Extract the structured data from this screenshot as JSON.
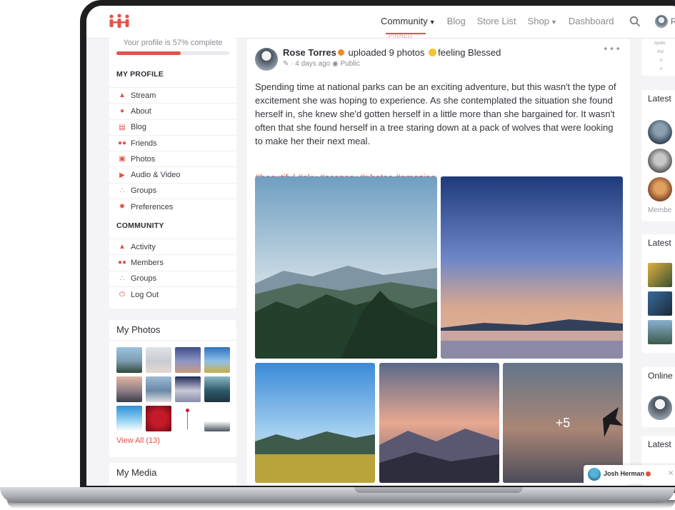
{
  "nav": {
    "items": [
      {
        "label": "Community",
        "dropdown": true,
        "active": true
      },
      {
        "label": "Blog",
        "dropdown": false,
        "active": false
      },
      {
        "label": "Store List",
        "dropdown": false,
        "active": false
      },
      {
        "label": "Shop",
        "dropdown": true,
        "active": false
      },
      {
        "label": "Dashboard",
        "dropdown": false,
        "active": false
      }
    ],
    "user_initial": "R"
  },
  "profile": {
    "completion_text": "Your profile is 57% complete",
    "completion_percent": 57
  },
  "sidebar": {
    "my_profile_heading": "MY PROFILE",
    "my_profile_items": [
      {
        "label": "Stream",
        "icon": "stream-icon"
      },
      {
        "label": "About",
        "icon": "person-icon"
      },
      {
        "label": "Blog",
        "icon": "blog-icon"
      },
      {
        "label": "Friends",
        "icon": "friends-icon"
      },
      {
        "label": "Photos",
        "icon": "camera-icon"
      },
      {
        "label": "Audio & Video",
        "icon": "video-icon"
      },
      {
        "label": "Groups",
        "icon": "groups-icon"
      },
      {
        "label": "Preferences",
        "icon": "gear-icon"
      }
    ],
    "community_heading": "COMMUNITY",
    "community_items": [
      {
        "label": "Activity",
        "icon": "activity-icon"
      },
      {
        "label": "Members",
        "icon": "members-icon"
      },
      {
        "label": "Groups",
        "icon": "groups-icon"
      },
      {
        "label": "Log Out",
        "icon": "power-icon"
      }
    ]
  },
  "my_photos": {
    "title": "My Photos",
    "view_all": "View All (13)"
  },
  "my_media": {
    "title": "My Media"
  },
  "post": {
    "pinned_label": "PINNED",
    "author": "Rose Torres",
    "action": "uploaded 9 photos",
    "feeling": "feeling Blessed",
    "time": "· 4 days ago",
    "visibility": "Public",
    "body": "Spending time at national parks can be an exciting adventure, but this wasn't the type of excitement she was hoping to experience. As she contemplated the situation she found herself in, she knew she'd gotten herself in a little more than she bargained for. It wasn't often that she found herself in a tree staring down at a pack of wolves that were looking to make her their next meal.",
    "hashtags": "#beautiful #sky #scenery #photos #amazing",
    "more_photos": "+5"
  },
  "right_sidebar": {
    "tags": [
      "#polls",
      "#sc",
      "#",
      "#"
    ],
    "latest_members_title": "Latest",
    "members_link": "Membe",
    "latest_photos_title": "Latest",
    "online_title": "Online",
    "latest_media_title": "Latest"
  },
  "chat": {
    "name": "Josh Herman",
    "close": "×"
  },
  "colors": {
    "accent": "#e2534a",
    "brand_logo": "#e2534a"
  }
}
